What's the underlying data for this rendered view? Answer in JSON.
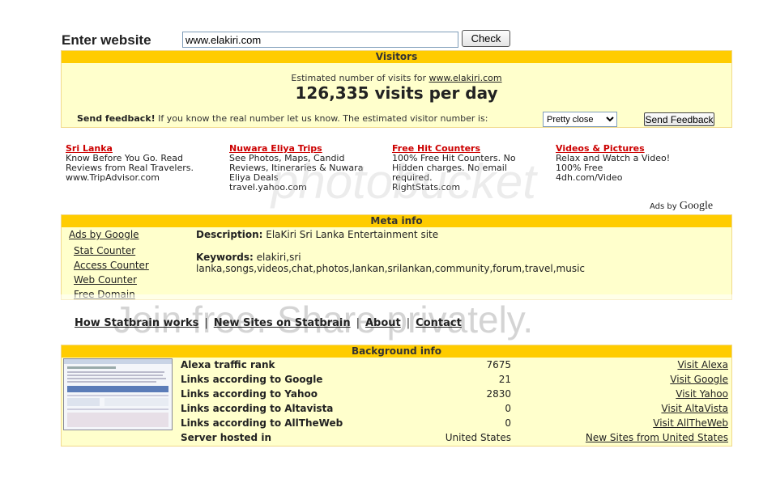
{
  "search": {
    "label": "Enter website",
    "value": "www.elakiri.com",
    "button": "Check"
  },
  "visitors": {
    "header": "Visitors",
    "estimate_prefix": "Estimated number of visits for ",
    "estimate_site": "www.elakiri.com",
    "visits_text": "126,335 visits per day",
    "feedback_bold": "Send feedback!",
    "feedback_text": " If you know the real number let us know. The estimated visitor number is:",
    "select_value": "Pretty close",
    "send_button": "Send Feedback"
  },
  "ads": [
    {
      "title": "Sri Lanka",
      "lines": [
        "Know Before You Go. Read",
        "Reviews from Real Travelers.",
        "www.TripAdvisor.com"
      ]
    },
    {
      "title": "Nuwara Eliya Trips",
      "lines": [
        "See Photos, Maps, Candid",
        "Reviews, Itineraries & Nuwara",
        "Eliya Deals",
        "travel.yahoo.com"
      ]
    },
    {
      "title": "Free Hit Counters",
      "lines": [
        "100% Free Hit Counters. No",
        "Hidden charges. No email",
        "required.",
        "RightStats.com"
      ]
    },
    {
      "title": "Videos & Pictures",
      "lines": [
        "Relax and Watch a Video!",
        "100% Free",
        "4dh.com/Video"
      ]
    }
  ],
  "ads_by": "Ads by",
  "ads_google": "Google",
  "meta": {
    "header": "Meta info",
    "ads_title": "Ads by Google",
    "links": [
      "Stat Counter",
      "Access Counter",
      "Web Counter",
      "Free Domain"
    ],
    "desc_label": "Description:",
    "desc_value": " ElaKiri Sri Lanka Entertainment site",
    "kw_label": "Keywords:",
    "kw_value": " elakiri,sri lanka,songs,videos,chat,photos,lankan,srilankan,community,forum,travel,music"
  },
  "nav": [
    "How Statbrain works",
    "New Sites on Statbrain",
    "About",
    "Contact"
  ],
  "nav_sep": "|",
  "watermark": {
    "text": "Join free. Share privately.",
    "logo": "photobucket"
  },
  "background": {
    "header": "Background info",
    "rows": [
      {
        "label": "Alexa traffic rank",
        "value": "7675",
        "link": "Visit Alexa"
      },
      {
        "label": "Links according to Google",
        "value": "21",
        "link": "Visit Google"
      },
      {
        "label": "Links according to Yahoo",
        "value": "2830",
        "link": "Visit Yahoo"
      },
      {
        "label": "Links according to Altavista",
        "value": "0",
        "link": "Visit AltaVista"
      },
      {
        "label": "Links according to AllTheWeb",
        "value": "0",
        "link": "Visit AllTheWeb"
      },
      {
        "label": "Server hosted in",
        "value": "United States",
        "link": "New Sites from United States"
      }
    ]
  }
}
